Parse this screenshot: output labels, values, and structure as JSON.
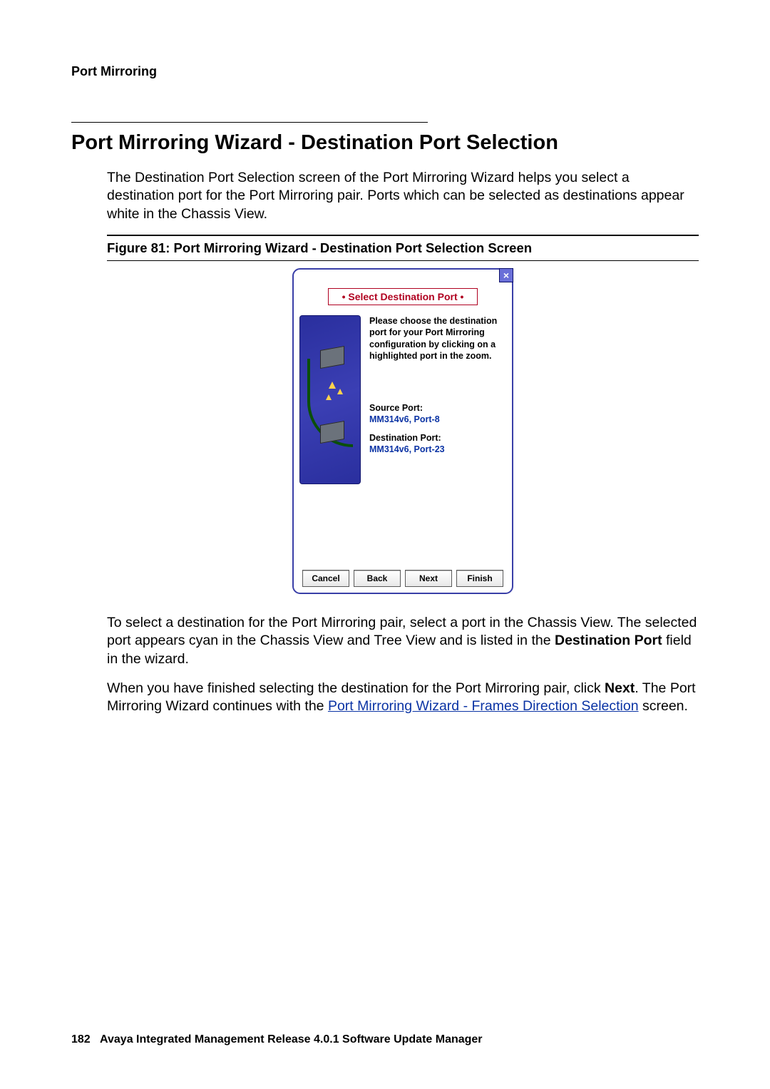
{
  "header": {
    "section": "Port Mirroring"
  },
  "title": "Port Mirroring Wizard - Destination Port Selection",
  "para1": "The Destination Port Selection screen of the Port Mirroring Wizard helps you select a destination port for the Port Mirroring pair. Ports which can be selected as destinations appear white in the Chassis View.",
  "figure": {
    "caption": "Figure 81: Port Mirroring Wizard - Destination Port Selection Screen"
  },
  "wizard": {
    "banner": "• Select Destination Port •",
    "instruction": "Please choose the destination port for your Port Mirroring configuration by clicking on a highlighted port in the zoom.",
    "source_label": "Source Port:",
    "source_value": "MM314v6, Port-8",
    "dest_label": "Destination Port:",
    "dest_value": "MM314v6, Port-23",
    "buttons": {
      "cancel": "Cancel",
      "back": "Back",
      "next": "Next",
      "finish": "Finish"
    }
  },
  "para2": {
    "t1": "To select a destination for the Port Mirroring pair, select a port in the Chassis View. The selected port appears cyan in the Chassis View and Tree View and is listed in the ",
    "bold1": "Destination Port",
    "t2": " field in the wizard."
  },
  "para3": {
    "t1": "When you have finished selecting the destination for the Port Mirroring pair, click ",
    "bold1": "Next",
    "t2": ". The Port Mirroring Wizard continues with the ",
    "link": "Port Mirroring Wizard - Frames Direction Selection",
    "t3": " screen."
  },
  "footer": {
    "page": "182",
    "text": "Avaya Integrated Management Release 4.0.1 Software Update Manager"
  }
}
